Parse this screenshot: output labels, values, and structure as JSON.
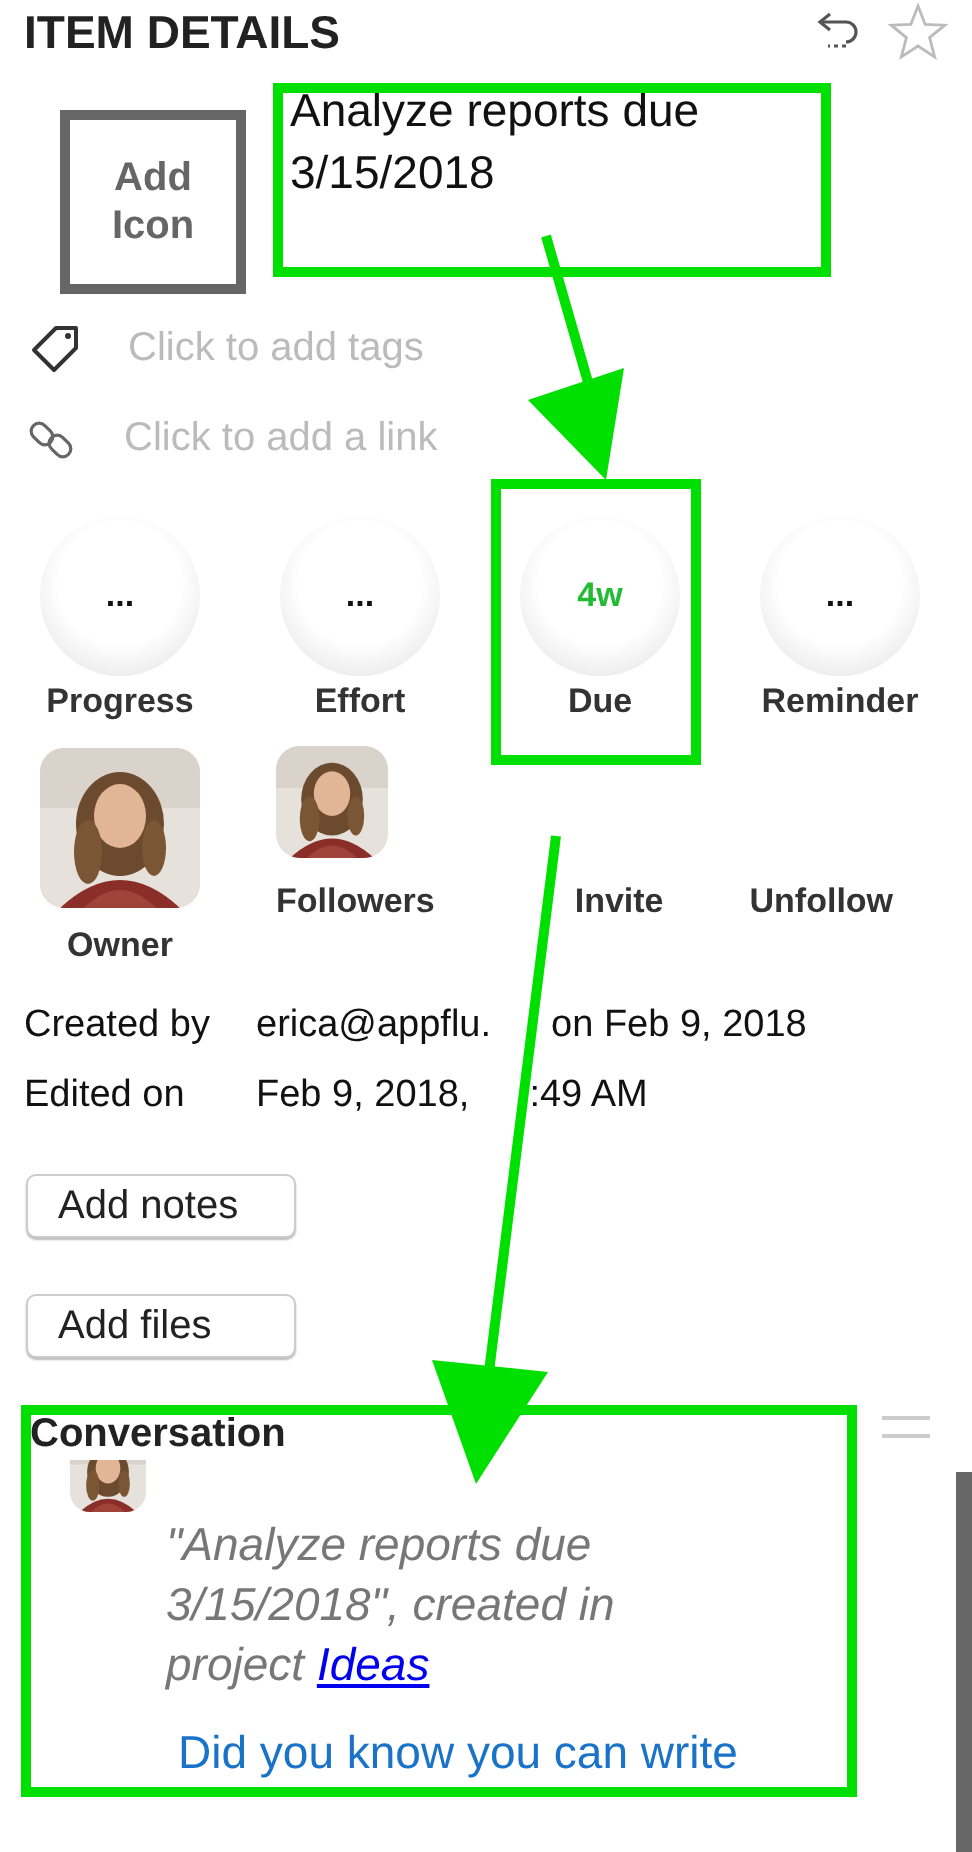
{
  "header": {
    "title": "ITEM DETAILS"
  },
  "item": {
    "icon_button": "Add Icon",
    "title": "Analyze reports due 3/15/2018"
  },
  "fields": [
    {
      "kind": "tags",
      "placeholder": "Click to add tags"
    },
    {
      "kind": "link",
      "placeholder": "Click to add a link"
    }
  ],
  "attributes": [
    {
      "label": "Progress",
      "value": "...",
      "set": false
    },
    {
      "label": "Effort",
      "value": "...",
      "set": false
    },
    {
      "label": "Due",
      "value": "4w",
      "set": true
    },
    {
      "label": "Reminder",
      "value": "...",
      "set": false
    }
  ],
  "people": {
    "owner_label": "Owner",
    "followers_label": "Followers",
    "actions": [
      "Invite",
      "Unfollow"
    ]
  },
  "meta": [
    {
      "label": "Created by",
      "value": "erica@appflu.",
      "suffix": "on Feb 9, 2018"
    },
    {
      "label": "Edited on",
      "value": "Feb 9, 2018,",
      "suffix": ":49 AM"
    }
  ],
  "buttons": [
    "Add notes",
    "Add files"
  ],
  "conversation": {
    "title": "Conversation",
    "message": "\"Analyze reports due 3/15/2018\", created in project",
    "link": "Ideas",
    "hint": "Did you know you can write"
  }
}
